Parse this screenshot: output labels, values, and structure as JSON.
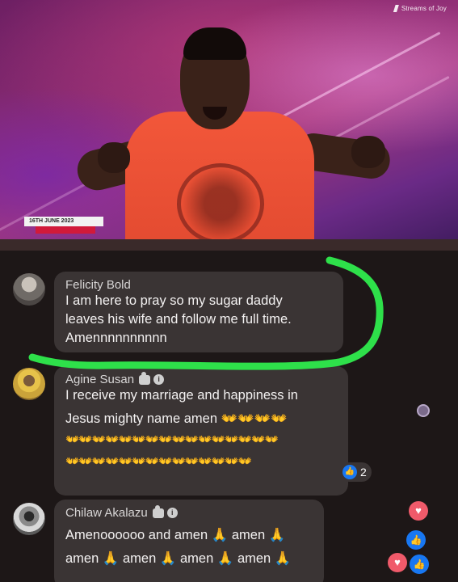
{
  "video": {
    "brand": "Streams of Joy",
    "date_badge": "16TH JUNE 2023"
  },
  "comments": [
    {
      "author": "Felicity Bold",
      "text_lines": [
        "I am here to pray so my sugar daddy",
        "leaves his wife and follow me full time.",
        "Amennnnnnnnnn"
      ]
    },
    {
      "author": "Agine Susan",
      "text_lines": [
        "I receive my marriage and happiness in",
        "Jesus mighty name amen 👐👐👐👐"
      ],
      "emoji_lines": [
        "👐👐👐👐👐👐👐👐👐👐👐👐👐👐👐👐",
        "👐👐👐👐👐👐👐👐👐👐👐👐👐👐"
      ],
      "reaction_count": "2"
    },
    {
      "author": "Chilaw Akalazu",
      "text_lines": [
        "Amenoooooo and amen 🙏 amen 🙏",
        "amen 🙏 amen 🙏 amen 🙏 amen 🙏"
      ]
    }
  ],
  "icons": {
    "like": "thumbs-up-icon",
    "heart": "heart-icon",
    "fan_badge": "top-fan-badge-icon",
    "info_badge": "badge-icon"
  },
  "colors": {
    "annotation": "#2ee04a",
    "comment_bubble": "#3a3434",
    "like_blue": "#1877f2",
    "heart_red": "#f05a6a"
  }
}
